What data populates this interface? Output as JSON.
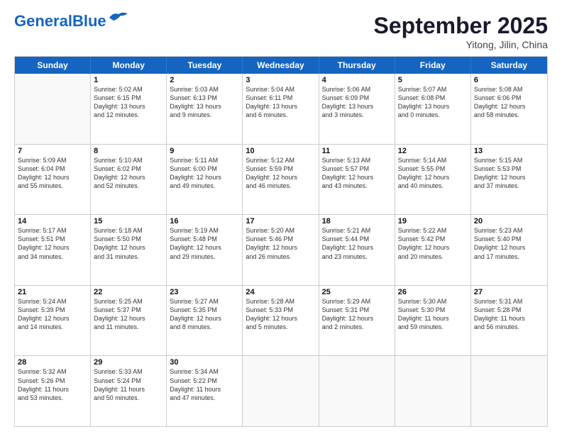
{
  "logo": {
    "line1": "General",
    "line2": "Blue"
  },
  "title": "September 2025",
  "location": "Yitong, Jilin, China",
  "days_header": [
    "Sunday",
    "Monday",
    "Tuesday",
    "Wednesday",
    "Thursday",
    "Friday",
    "Saturday"
  ],
  "weeks": [
    [
      {
        "day": "",
        "info": ""
      },
      {
        "day": "1",
        "info": "Sunrise: 5:02 AM\nSunset: 6:15 PM\nDaylight: 13 hours\nand 12 minutes."
      },
      {
        "day": "2",
        "info": "Sunrise: 5:03 AM\nSunset: 6:13 PM\nDaylight: 13 hours\nand 9 minutes."
      },
      {
        "day": "3",
        "info": "Sunrise: 5:04 AM\nSunset: 6:11 PM\nDaylight: 13 hours\nand 6 minutes."
      },
      {
        "day": "4",
        "info": "Sunrise: 5:06 AM\nSunset: 6:09 PM\nDaylight: 13 hours\nand 3 minutes."
      },
      {
        "day": "5",
        "info": "Sunrise: 5:07 AM\nSunset: 6:08 PM\nDaylight: 13 hours\nand 0 minutes."
      },
      {
        "day": "6",
        "info": "Sunrise: 5:08 AM\nSunset: 6:06 PM\nDaylight: 12 hours\nand 58 minutes."
      }
    ],
    [
      {
        "day": "7",
        "info": "Sunrise: 5:09 AM\nSunset: 6:04 PM\nDaylight: 12 hours\nand 55 minutes."
      },
      {
        "day": "8",
        "info": "Sunrise: 5:10 AM\nSunset: 6:02 PM\nDaylight: 12 hours\nand 52 minutes."
      },
      {
        "day": "9",
        "info": "Sunrise: 5:11 AM\nSunset: 6:00 PM\nDaylight: 12 hours\nand 49 minutes."
      },
      {
        "day": "10",
        "info": "Sunrise: 5:12 AM\nSunset: 5:59 PM\nDaylight: 12 hours\nand 46 minutes."
      },
      {
        "day": "11",
        "info": "Sunrise: 5:13 AM\nSunset: 5:57 PM\nDaylight: 12 hours\nand 43 minutes."
      },
      {
        "day": "12",
        "info": "Sunrise: 5:14 AM\nSunset: 5:55 PM\nDaylight: 12 hours\nand 40 minutes."
      },
      {
        "day": "13",
        "info": "Sunrise: 5:15 AM\nSunset: 5:53 PM\nDaylight: 12 hours\nand 37 minutes."
      }
    ],
    [
      {
        "day": "14",
        "info": "Sunrise: 5:17 AM\nSunset: 5:51 PM\nDaylight: 12 hours\nand 34 minutes."
      },
      {
        "day": "15",
        "info": "Sunrise: 5:18 AM\nSunset: 5:50 PM\nDaylight: 12 hours\nand 31 minutes."
      },
      {
        "day": "16",
        "info": "Sunrise: 5:19 AM\nSunset: 5:48 PM\nDaylight: 12 hours\nand 29 minutes."
      },
      {
        "day": "17",
        "info": "Sunrise: 5:20 AM\nSunset: 5:46 PM\nDaylight: 12 hours\nand 26 minutes."
      },
      {
        "day": "18",
        "info": "Sunrise: 5:21 AM\nSunset: 5:44 PM\nDaylight: 12 hours\nand 23 minutes."
      },
      {
        "day": "19",
        "info": "Sunrise: 5:22 AM\nSunset: 5:42 PM\nDaylight: 12 hours\nand 20 minutes."
      },
      {
        "day": "20",
        "info": "Sunrise: 5:23 AM\nSunset: 5:40 PM\nDaylight: 12 hours\nand 17 minutes."
      }
    ],
    [
      {
        "day": "21",
        "info": "Sunrise: 5:24 AM\nSunset: 5:39 PM\nDaylight: 12 hours\nand 14 minutes."
      },
      {
        "day": "22",
        "info": "Sunrise: 5:25 AM\nSunset: 5:37 PM\nDaylight: 12 hours\nand 11 minutes."
      },
      {
        "day": "23",
        "info": "Sunrise: 5:27 AM\nSunset: 5:35 PM\nDaylight: 12 hours\nand 8 minutes."
      },
      {
        "day": "24",
        "info": "Sunrise: 5:28 AM\nSunset: 5:33 PM\nDaylight: 12 hours\nand 5 minutes."
      },
      {
        "day": "25",
        "info": "Sunrise: 5:29 AM\nSunset: 5:31 PM\nDaylight: 12 hours\nand 2 minutes."
      },
      {
        "day": "26",
        "info": "Sunrise: 5:30 AM\nSunset: 5:30 PM\nDaylight: 11 hours\nand 59 minutes."
      },
      {
        "day": "27",
        "info": "Sunrise: 5:31 AM\nSunset: 5:28 PM\nDaylight: 11 hours\nand 56 minutes."
      }
    ],
    [
      {
        "day": "28",
        "info": "Sunrise: 5:32 AM\nSunset: 5:26 PM\nDaylight: 11 hours\nand 53 minutes."
      },
      {
        "day": "29",
        "info": "Sunrise: 5:33 AM\nSunset: 5:24 PM\nDaylight: 11 hours\nand 50 minutes."
      },
      {
        "day": "30",
        "info": "Sunrise: 5:34 AM\nSunset: 5:22 PM\nDaylight: 11 hours\nand 47 minutes."
      },
      {
        "day": "",
        "info": ""
      },
      {
        "day": "",
        "info": ""
      },
      {
        "day": "",
        "info": ""
      },
      {
        "day": "",
        "info": ""
      }
    ]
  ]
}
